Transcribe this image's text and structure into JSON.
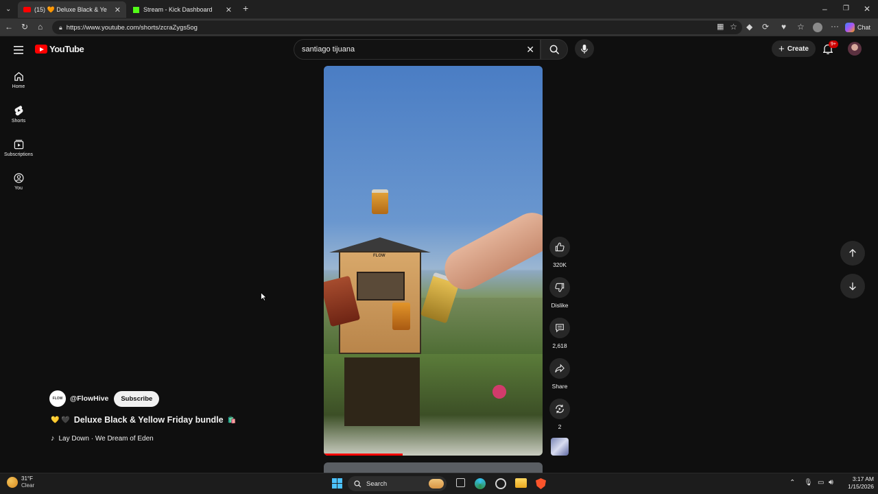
{
  "browser": {
    "tabs": [
      {
        "label": "(15) 🧡 Deluxe Black & Ye",
        "active": true
      },
      {
        "label": "Stream - Kick Dashboard",
        "active": false
      }
    ],
    "url": "https://www.youtube.com/shorts/zcraZygs5og",
    "copilot_label": "Chat"
  },
  "youtube": {
    "logo_text": "YouTube",
    "search_value": "santiago tijuana",
    "create_label": "Create",
    "notif_badge": "9+",
    "nav": [
      {
        "label": "Home",
        "icon": "home-icon"
      },
      {
        "label": "Shorts",
        "icon": "shorts-icon"
      },
      {
        "label": "Subscriptions",
        "icon": "subscriptions-icon"
      },
      {
        "label": "You",
        "icon": "you-icon"
      }
    ]
  },
  "short": {
    "channel": "@FlowHive",
    "avatar_text": "FLOW",
    "subscribe_label": "Subscribe",
    "title_emoji_left": "💛 🖤",
    "title": "Deluxe Black & Yellow Friday bundle",
    "title_emoji_right": "🛍️",
    "music": "Lay Down · We Dream of Eden",
    "progress": 0.36,
    "like_count": "320K",
    "dislike_label": "Dislike",
    "comment_count": "2,618",
    "share_label": "Share",
    "remix_count": "2",
    "hive_brand": "FLOW"
  },
  "taskbar": {
    "weather_temp": "31°F",
    "weather_desc": "Clear",
    "search_label": "Search",
    "time": "3:17 AM",
    "date": "1/15/2026"
  }
}
